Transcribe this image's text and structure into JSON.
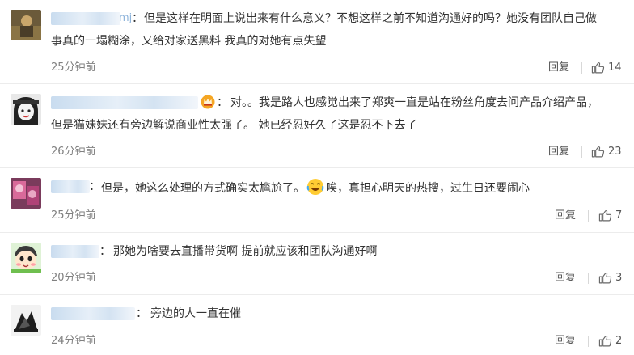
{
  "comments": [
    {
      "username_visible": "mj",
      "text_line1": "但是这样在明面上说出来有什么意义？不想这样之前不知道沟通好的吗？她没有团队自己做",
      "text_line2": "事真的一塌糊涂，又给对家送黑料 我真的对她有点失望",
      "time": "25分钟前",
      "reply_label": "回复",
      "likes": "14"
    },
    {
      "username_visible": "",
      "text_line1": "对。。我是路人也感觉出来了郑爽一直是站在粉丝角度去问产品介绍产品，",
      "text_line2": "但是猫妹妹还有旁边解说商业性太强了。 她已经忍好久了这是忍不下去了",
      "time": "26分钟前",
      "reply_label": "回复",
      "likes": "23"
    },
    {
      "username_visible": "",
      "text_part1": "但是，她这么处理的方式确实太尴尬了。",
      "text_part2": "唉，真担心明天的热搜，过生日还要闹心",
      "time": "25分钟前",
      "reply_label": "回复",
      "likes": "7"
    },
    {
      "username_visible": "",
      "text_line1": "那她为啥要去直播带货啊 提前就应该和团队沟通好啊",
      "time": "20分钟前",
      "reply_label": "回复",
      "likes": "3"
    },
    {
      "username_visible": "",
      "text_line1": "旁边的人一直在催",
      "time": "24分钟前",
      "reply_label": "回复",
      "likes": "2"
    }
  ],
  "icons": {
    "like": "thumbs-up-icon",
    "badge": "vip-crown-icon",
    "emoji": "laughing-crying-emoji-icon"
  },
  "colors": {
    "username_blur": "#c9dcef",
    "text": "#333333",
    "meta": "#808080",
    "accent_badge": "#f5a623"
  }
}
